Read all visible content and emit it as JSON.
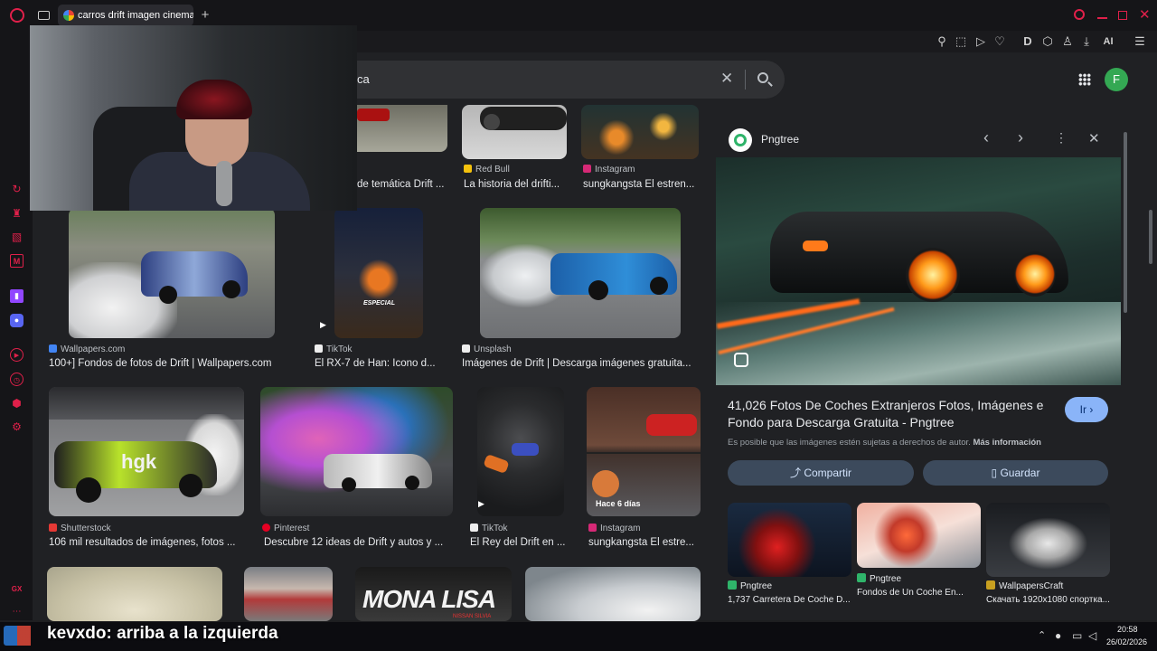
{
  "browser": {
    "tab_title": "carros drift imagen cinema",
    "new_tab": "+",
    "ai_label": "AI",
    "accent": "#e0204a"
  },
  "search": {
    "query_visible": "ca",
    "clear_icon": "close-icon",
    "search_icon": "search-icon",
    "avatar_letter": "F"
  },
  "results": [
    {
      "source": "",
      "title": "de temática Drift ...",
      "src_color": "#888"
    },
    {
      "source": "Red Bull",
      "title": "La historia del drifti...",
      "src_color": "#f4c20d"
    },
    {
      "source": "Instagram",
      "title": "sungkangsta El estren...",
      "src_color": "#d62976"
    },
    {
      "source": "Wallpapers.com",
      "title": "100+] Fondos de fotos de Drift | Wallpapers.com",
      "src_color": "#4285f4"
    },
    {
      "source": "TikTok",
      "title": "El RX-7 de Han: Ícono d...",
      "src_color": "#eee"
    },
    {
      "source": "Unsplash",
      "title": "Imágenes de Drift | Descarga imágenes gratuita...",
      "src_color": "#eee"
    },
    {
      "source": "Shutterstock",
      "title": "106 mil resultados de imágenes, fotos ...",
      "src_color": "#e53935"
    },
    {
      "source": "Pinterest",
      "title": "Descubre 12 ideas de Drift y autos y ...",
      "src_color": "#e60023"
    },
    {
      "source": "TikTok",
      "title": "El Rey del Drift en ...",
      "src_color": "#eee"
    },
    {
      "source": "Instagram",
      "title": "sungkangsta El estre...",
      "src_color": "#d62976"
    }
  ],
  "result_badges": {
    "hace": "Hace 6 días",
    "hgk": "hgk",
    "especial": "ESPECIAL",
    "mona": "MONA LISA",
    "nissan": "NISSAN SILVIA"
  },
  "panel": {
    "source": "Pngtree",
    "title": "41,026 Fotos De Coches Extranjeros Fotos, Imágenes e Fondo para Descarga Gratuita - Pngtree",
    "go": "Ir",
    "copyright": "Es posible que las imágenes estén sujetas a derechos de autor.",
    "more_info": "Más información",
    "share": "Compartir",
    "save": "Guardar",
    "related": [
      {
        "source": "Pngtree",
        "title": "1,737 Carretera De Coche D..."
      },
      {
        "source": "Pngtree",
        "title": "Fondos de Un Coche En..."
      },
      {
        "source": "WallpapersCraft",
        "title": "Скачать 1920x1080 спортка..."
      }
    ]
  },
  "chat": {
    "user": "kevxdo",
    "message": ": arriba a la izquierda"
  },
  "taskbar": {
    "time": "20:58",
    "date": "26/02/2026"
  },
  "sidebar_label": "GX"
}
